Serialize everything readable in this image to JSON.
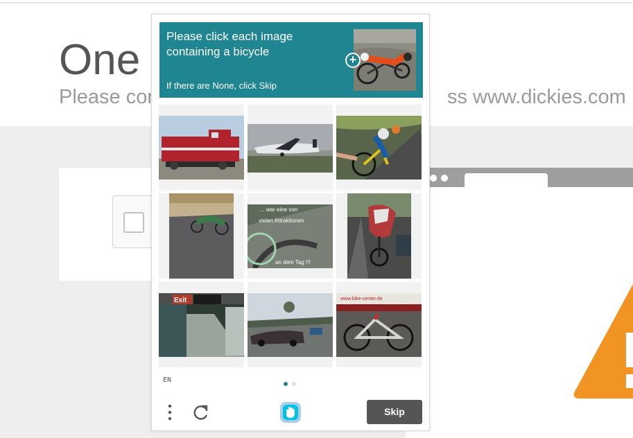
{
  "background": {
    "title": "One r",
    "subtitle_left": "Please com",
    "subtitle_right": "ss www.dickies.com"
  },
  "challenge": {
    "prompt": "Please click each image containing a bicycle",
    "sub_prompt": "If there are None, click Skip",
    "plus_symbol": "+",
    "language": "EN",
    "skip_label": "Skip",
    "accent_color": "#1e8591",
    "tiles": [
      {
        "label": "red freight locomotive"
      },
      {
        "label": "airplane on runway"
      },
      {
        "label": "cyclists on road"
      },
      {
        "label": "recumbent bicycle rider"
      },
      {
        "label": "…war eine von vielen Attraktionen an dem Tag !!!"
      },
      {
        "label": "rider with flag cape"
      },
      {
        "label": "subway station exit"
      },
      {
        "label": "cars on street"
      },
      {
        "label": "bicycles at shop"
      }
    ],
    "tile_caption_lines": [
      "... war eine von",
      "vielen Attraktionen",
      "an dem Tag !!!"
    ],
    "subway_sign": "Exit",
    "shop_sign": "www.bike-center.de",
    "pages": {
      "current": 1,
      "total": 2
    }
  },
  "icons": [
    "menu-dots-icon",
    "refresh-icon",
    "hcaptcha-logo-icon",
    "plus-icon",
    "warning-icon"
  ]
}
